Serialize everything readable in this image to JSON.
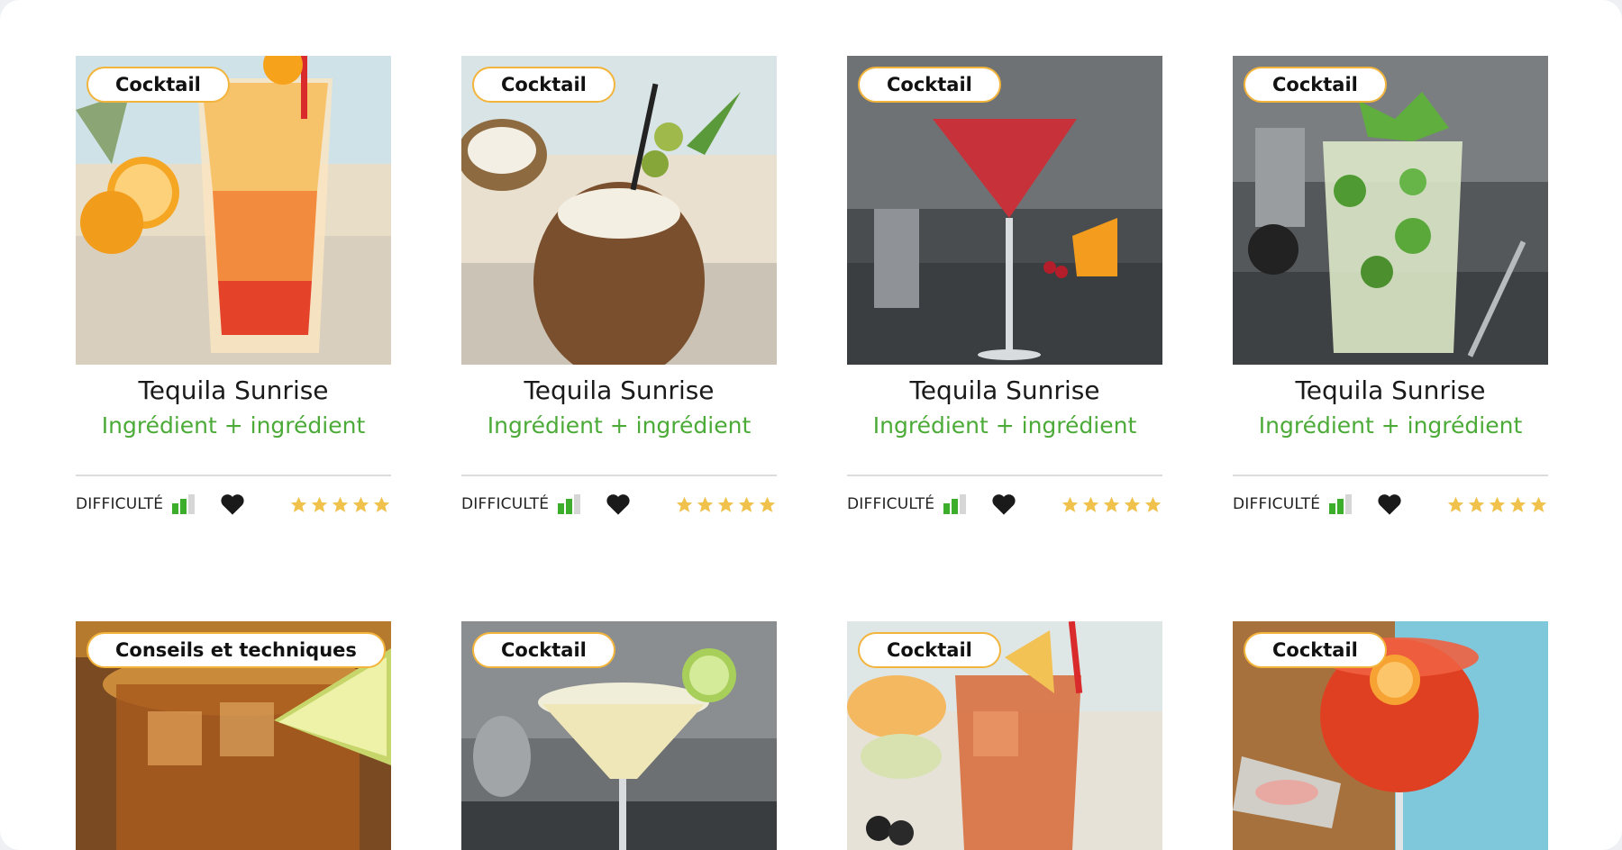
{
  "cards": [
    {
      "tag": "Cocktail",
      "title": "Tequila Sunrise",
      "subtitle": "Ingrédient + ingrédient",
      "difficulty_label": "DIFFICULTÉ",
      "difficulty_level": 2,
      "difficulty_max": 3,
      "rating": 5,
      "image": "tequila-sunrise-glass"
    },
    {
      "tag": "Cocktail",
      "title": "Tequila Sunrise",
      "subtitle": "Ingrédient + ingrédient",
      "difficulty_label": "DIFFICULTÉ",
      "difficulty_level": 2,
      "difficulty_max": 3,
      "rating": 5,
      "image": "coconut-cocktail"
    },
    {
      "tag": "Cocktail",
      "title": "Tequila Sunrise",
      "subtitle": "Ingrédient + ingrédient",
      "difficulty_label": "DIFFICULTÉ",
      "difficulty_level": 2,
      "difficulty_max": 3,
      "rating": 5,
      "image": "red-martini-glass"
    },
    {
      "tag": "Cocktail",
      "title": "Tequila Sunrise",
      "subtitle": "Ingrédient + ingrédient",
      "difficulty_label": "DIFFICULTÉ",
      "difficulty_level": 2,
      "difficulty_max": 3,
      "rating": 5,
      "image": "mojito-glass"
    },
    {
      "tag": "Conseils et techniques",
      "image": "whisky-rocks-glass"
    },
    {
      "tag": "Cocktail",
      "image": "margarita-glass"
    },
    {
      "tag": "Cocktail",
      "image": "iced-tea-cocktail"
    },
    {
      "tag": "Cocktail",
      "image": "spritz-wine-glass"
    }
  ],
  "colors": {
    "accent_green": "#4cab38",
    "tag_border": "#f3b43b",
    "star": "#f0c24b",
    "difficulty_on": "#3dae2b",
    "difficulty_off": "#d6d6d6"
  }
}
